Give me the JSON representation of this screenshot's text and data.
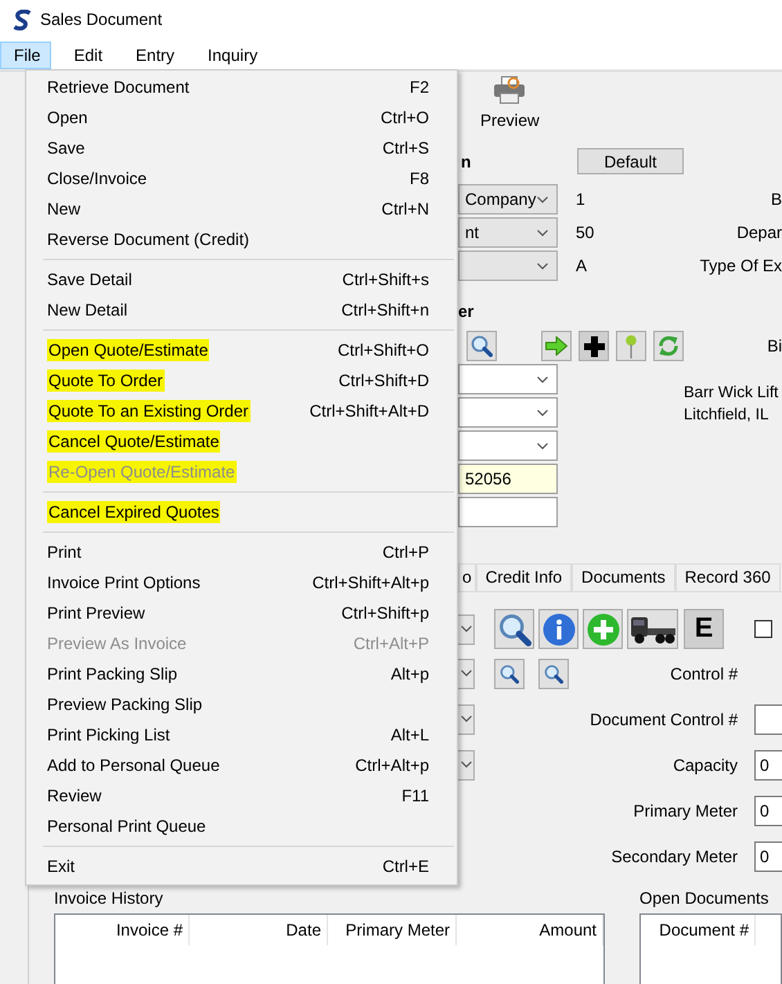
{
  "window": {
    "title": "Sales Document"
  },
  "menu_bar": [
    {
      "label": "File",
      "selected": true
    },
    {
      "label": "Edit",
      "selected": false
    },
    {
      "label": "Entry",
      "selected": false
    },
    {
      "label": "Inquiry",
      "selected": false
    }
  ],
  "file_menu": {
    "groups": [
      {
        "items": [
          {
            "label": "Retrieve Document",
            "shortcut": "F2",
            "disabled": false,
            "highlighted": false
          },
          {
            "label": "Open",
            "shortcut": "Ctrl+O",
            "disabled": false,
            "highlighted": false
          },
          {
            "label": "Save",
            "shortcut": "Ctrl+S",
            "disabled": false,
            "highlighted": false
          },
          {
            "label": "Close/Invoice",
            "shortcut": "F8",
            "disabled": false,
            "highlighted": false
          },
          {
            "label": "New",
            "shortcut": "Ctrl+N",
            "disabled": false,
            "highlighted": false
          },
          {
            "label": "Reverse Document (Credit)",
            "disabled": false,
            "highlighted": false
          }
        ]
      },
      {
        "items": [
          {
            "label": "Save Detail",
            "shortcut": "Ctrl+Shift+s",
            "disabled": false,
            "highlighted": false
          },
          {
            "label": "New Detail",
            "shortcut": "Ctrl+Shift+n",
            "disabled": false,
            "highlighted": false
          }
        ]
      },
      {
        "items": [
          {
            "label": "Open Quote/Estimate",
            "shortcut": "Ctrl+Shift+O",
            "disabled": false,
            "highlighted": true
          },
          {
            "label": "Quote To Order",
            "shortcut": "Ctrl+Shift+D",
            "disabled": false,
            "highlighted": true
          },
          {
            "label": "Quote To an Existing Order",
            "shortcut": "Ctrl+Shift+Alt+D",
            "disabled": false,
            "highlighted": true
          },
          {
            "label": "Cancel Quote/Estimate",
            "disabled": false,
            "highlighted": true
          },
          {
            "label": "Re-Open Quote/Estimate",
            "disabled": true,
            "highlighted": true
          }
        ]
      },
      {
        "items": [
          {
            "label": "Cancel Expired Quotes",
            "disabled": false,
            "highlighted": true
          }
        ]
      },
      {
        "items": [
          {
            "label": "Print",
            "shortcut": "Ctrl+P",
            "disabled": false,
            "highlighted": false
          },
          {
            "label": "Invoice Print Options",
            "shortcut": "Ctrl+Shift+Alt+p",
            "disabled": false,
            "highlighted": false
          },
          {
            "label": "Print Preview",
            "shortcut": "Ctrl+Shift+p",
            "disabled": false,
            "highlighted": false
          },
          {
            "label": "Preview As Invoice",
            "shortcut": "Ctrl+Alt+P",
            "disabled": true,
            "highlighted": false
          },
          {
            "label": "Print Packing Slip",
            "shortcut": "Alt+p",
            "disabled": false,
            "highlighted": false
          },
          {
            "label": "Preview Packing Slip",
            "disabled": false,
            "highlighted": false
          },
          {
            "label": "Print Picking List",
            "shortcut": "Alt+L",
            "disabled": false,
            "highlighted": false
          },
          {
            "label": "Add to Personal Queue",
            "shortcut": "Ctrl+Alt+p",
            "disabled": false,
            "highlighted": false
          },
          {
            "label": "Review",
            "shortcut": "F11",
            "disabled": false,
            "highlighted": false
          },
          {
            "label": "Personal Print Queue",
            "disabled": false,
            "highlighted": false
          }
        ]
      },
      {
        "items": [
          {
            "label": "Exit",
            "shortcut": "Ctrl+E",
            "disabled": false,
            "highlighted": false
          }
        ]
      }
    ]
  },
  "toolbar": [
    {
      "label": "Preview"
    }
  ],
  "header": {
    "heading": "n",
    "default_button": "Default",
    "rows": [
      {
        "dropdown": "Company",
        "value": "1",
        "label": "B"
      },
      {
        "dropdown": "nt",
        "value": "50",
        "label": "Depar"
      },
      {
        "value": "A",
        "label": "Type Of Ex"
      }
    ]
  },
  "customer": {
    "heading": "er",
    "side_label": "Bi",
    "fields": [
      {
        "kind": "dropdown"
      },
      {
        "kind": "dropdown"
      },
      {
        "kind": "dropdown"
      },
      {
        "kind": "required-input",
        "value": "52056"
      },
      {
        "kind": "input"
      }
    ],
    "address": [
      "Barr Wick Lift",
      "Litchfield, IL"
    ]
  },
  "tabs": [
    {
      "label": "o",
      "selected": false
    },
    {
      "label": "Credit Info",
      "selected": false
    },
    {
      "label": "Documents",
      "selected": false
    },
    {
      "label": "Record 360",
      "selected": false
    }
  ],
  "detail": {
    "e_button": "E",
    "checkbox": {
      "checked": false
    },
    "fields": [
      {
        "label": "Control #",
        "kind": "label"
      },
      {
        "label": "Document Control #",
        "kind": "field"
      },
      {
        "label": "Capacity",
        "kind": "field",
        "value": "0"
      },
      {
        "label": "Primary Meter",
        "kind": "field",
        "value": "0"
      },
      {
        "label": "Secondary Meter",
        "kind": "field",
        "value": "0"
      }
    ]
  },
  "invoice_history": {
    "title": "Invoice History",
    "columns": [
      "Invoice #",
      "Date",
      "Primary Meter",
      "Amount"
    ]
  },
  "open_documents": {
    "title": "Open Documents",
    "columns": [
      "Document #"
    ]
  }
}
